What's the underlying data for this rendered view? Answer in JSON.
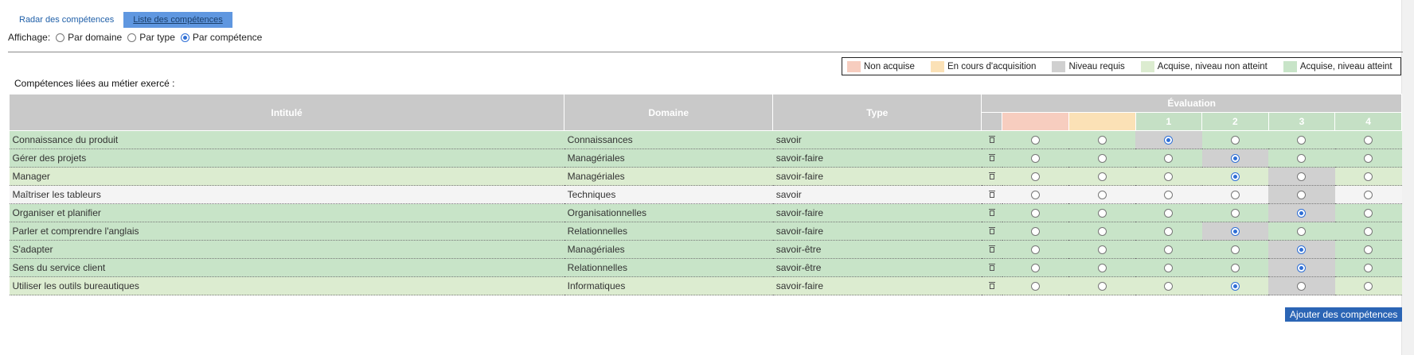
{
  "tabs": [
    {
      "label": "Radar des compétences",
      "active": false
    },
    {
      "label": "Liste des compétences",
      "active": true
    }
  ],
  "display": {
    "label": "Affichage:",
    "options": [
      {
        "label": "Par domaine",
        "checked": false
      },
      {
        "label": "Par type",
        "checked": false
      },
      {
        "label": "Par compétence",
        "checked": true
      }
    ]
  },
  "legend": [
    {
      "label": "Non acquise",
      "color": "#f7cdbf"
    },
    {
      "label": "En cours d'acquisition",
      "color": "#fbe1b6"
    },
    {
      "label": "Niveau requis",
      "color": "#d0d0d0"
    },
    {
      "label": "Acquise, niveau non atteint",
      "color": "#dcecd0"
    },
    {
      "label": "Acquise, niveau atteint",
      "color": "#c8e4c8"
    }
  ],
  "section_title": "Compétences liées au métier exercé :",
  "table": {
    "headers": {
      "title": "Intitulé",
      "domain": "Domaine",
      "type": "Type",
      "evaluation": "Évaluation"
    },
    "levels": [
      "1",
      "2",
      "3",
      "4"
    ],
    "rows": [
      {
        "title": "Connaissance du produit",
        "domain": "Connaissances",
        "type": "savoir",
        "required": 1,
        "selected": 1,
        "row_color": "#c8e4c8"
      },
      {
        "title": "Gérer des projets",
        "domain": "Managériales",
        "type": "savoir-faire",
        "required": 2,
        "selected": 2,
        "row_color": "#c8e4c8"
      },
      {
        "title": "Manager",
        "domain": "Managériales",
        "type": "savoir-faire",
        "required": 3,
        "selected": 2,
        "row_color": "#dcecd0"
      },
      {
        "title": "Maîtriser les tableurs",
        "domain": "Techniques",
        "type": "savoir",
        "required": 3,
        "selected": 0,
        "row_color": "#f4f4f4"
      },
      {
        "title": "Organiser et planifier",
        "domain": "Organisationnelles",
        "type": "savoir-faire",
        "required": 3,
        "selected": 3,
        "row_color": "#c8e4c8"
      },
      {
        "title": "Parler et comprendre l'anglais",
        "domain": "Relationnelles",
        "type": "savoir-faire",
        "required": 2,
        "selected": 2,
        "row_color": "#c8e4c8"
      },
      {
        "title": "S'adapter",
        "domain": "Managériales",
        "type": "savoir-être",
        "required": 3,
        "selected": 3,
        "row_color": "#c8e4c8"
      },
      {
        "title": "Sens du service client",
        "domain": "Relationnelles",
        "type": "savoir-être",
        "required": 3,
        "selected": 3,
        "row_color": "#c8e4c8"
      },
      {
        "title": "Utiliser les outils bureautiques",
        "domain": "Informatiques",
        "type": "savoir-faire",
        "required": 3,
        "selected": 2,
        "row_color": "#dcecd0"
      }
    ]
  },
  "add_button": "Ajouter des compétences",
  "colors": {
    "required_cell": "#d0d0d0",
    "accent": "#2b65b5"
  }
}
